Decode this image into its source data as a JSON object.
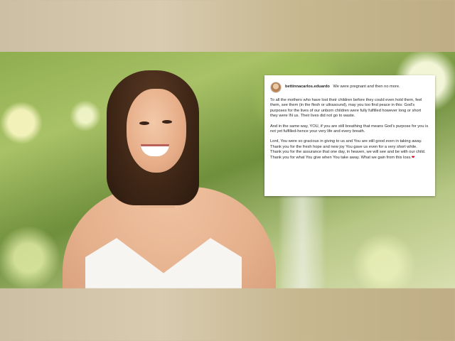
{
  "post": {
    "username": "bettinnacarlos.eduardo",
    "headline": "We were pregnant and then no more.",
    "paragraphs": [
      "To all the mothers who have lost their children before they could even hold them, feel them, see them (in the flesh or ultrasound), may you too find peace in this: God's purposes for the lives of our unborn children were fully fulfilled however long or short they were IN us. Their lives did not go to waste.",
      "And in the same way, YOU, if you are still breathing that means God's purpose for you is not yet fulfilled-hence your very life and every breath.",
      "Lord, You were so gracious in giving to us and You are still good even in taking away. Thank you for the fresh hope and new joy You gave us even for a very short while. Thank you for the assurance that one day, in heaven, we will see and be with our child. Thank you for what You give when You take away. What we gain from this loss."
    ],
    "end_symbol": "❤"
  }
}
